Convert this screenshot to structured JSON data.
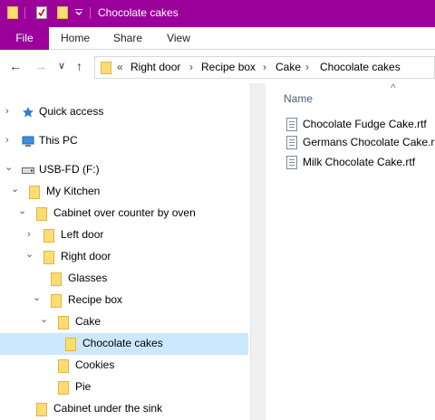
{
  "window": {
    "title": "Chocolate cakes",
    "accent_color": "#9b009b"
  },
  "ribbon": {
    "tabs": [
      "File",
      "Home",
      "Share",
      "View"
    ]
  },
  "nav_buttons": {
    "back": "←",
    "forward": "→",
    "recent": "∨",
    "up": "↑"
  },
  "address": {
    "overflow": "«",
    "crumbs": [
      "Right door",
      "Recipe box",
      "Cake",
      "Chocolate cakes"
    ]
  },
  "tree": [
    {
      "label": "Quick access",
      "icon": "star-icon",
      "chevron": "›",
      "level": 0
    },
    {
      "label": "This PC",
      "icon": "computer-icon",
      "chevron": "›",
      "level": 0
    },
    {
      "label": "USB-FD (F:)",
      "icon": "drive-icon",
      "chevron": "⌄",
      "level": 0
    },
    {
      "label": "My Kitchen",
      "icon": "folder-icon",
      "chevron": "⌄",
      "level": 1
    },
    {
      "label": "Cabinet over counter by oven",
      "icon": "folder-icon",
      "chevron": "⌄",
      "level": 2
    },
    {
      "label": "Left door",
      "icon": "folder-icon",
      "chevron": "›",
      "level": 3
    },
    {
      "label": "Right door",
      "icon": "folder-icon",
      "chevron": "⌄",
      "level": 3
    },
    {
      "label": "Glasses",
      "icon": "folder-icon",
      "chevron": "",
      "level": 4
    },
    {
      "label": "Recipe box",
      "icon": "folder-icon",
      "chevron": "⌄",
      "level": 4
    },
    {
      "label": "Cake",
      "icon": "folder-icon",
      "chevron": "⌄",
      "level": 5
    },
    {
      "label": "Chocolate cakes",
      "icon": "folder-icon",
      "chevron": "",
      "level": 6,
      "selected": true
    },
    {
      "label": "Cookies",
      "icon": "folder-icon",
      "chevron": "",
      "level": 5
    },
    {
      "label": "Pie",
      "icon": "folder-icon",
      "chevron": "",
      "level": 5
    },
    {
      "label": "Cabinet under the sink",
      "icon": "folder-icon",
      "chevron": "",
      "level": 3
    }
  ],
  "content": {
    "column_name": "Name",
    "sort_indicator": "^",
    "files": [
      "Chocolate Fudge Cake.rtf",
      "Germans Chocolate Cake.rtf",
      "Milk Chocolate Cake.rtf"
    ]
  }
}
